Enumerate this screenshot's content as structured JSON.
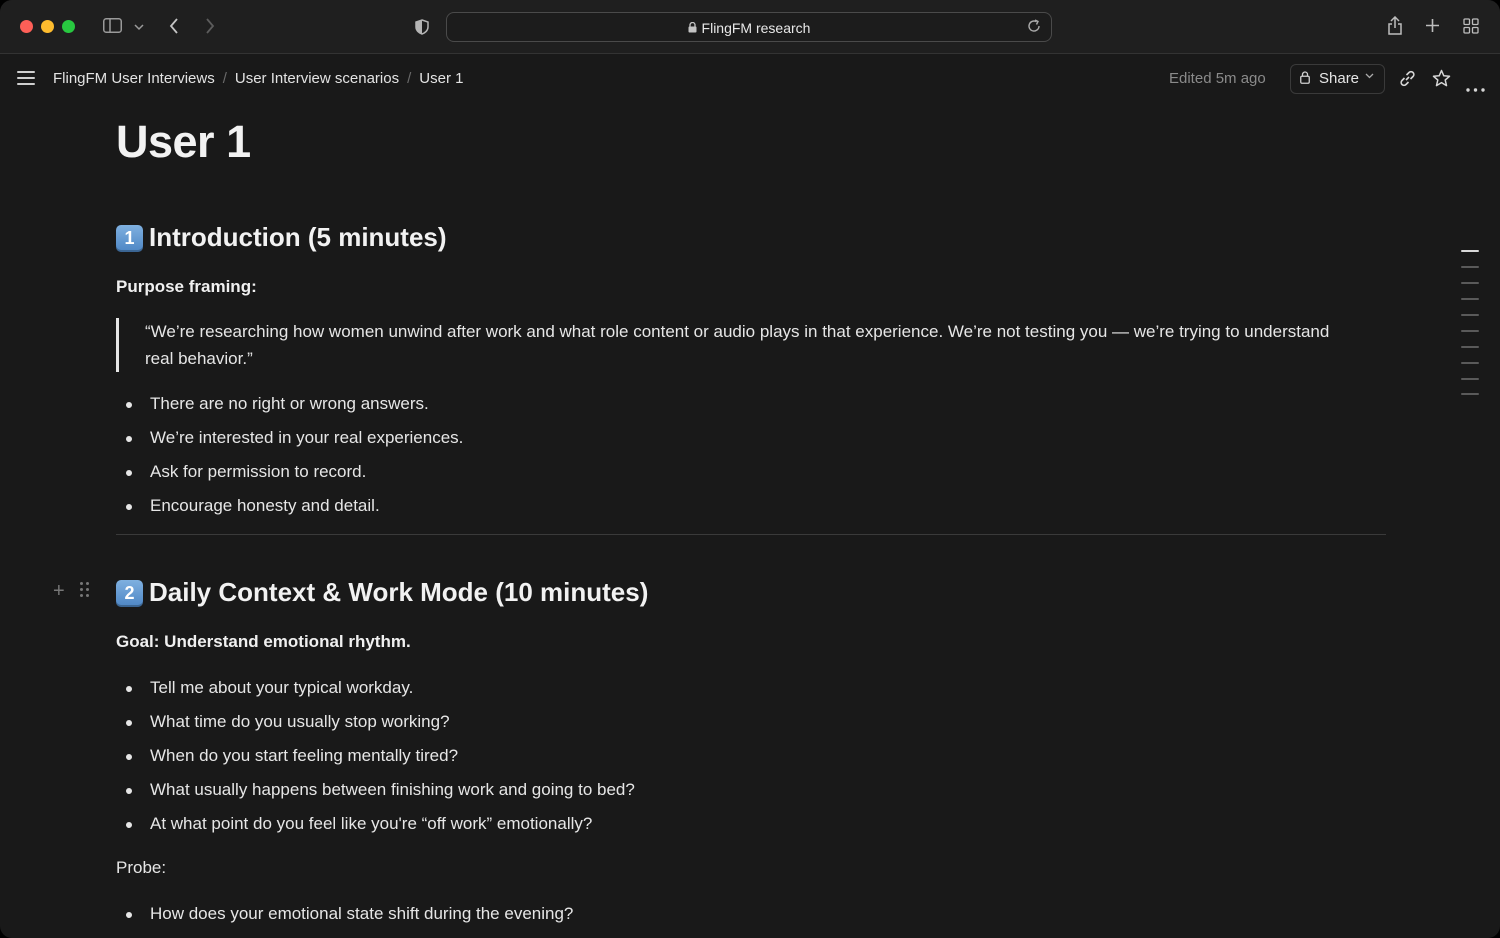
{
  "browser": {
    "url_text": "FlingFM research",
    "icons": [
      "sidebar-toggle-icon",
      "chevron-down-icon",
      "back-icon",
      "forward-icon",
      "shield-icon",
      "lock-icon",
      "reload-icon",
      "share-icon",
      "new-tab-icon",
      "tab-overview-icon"
    ]
  },
  "header": {
    "breadcrumb": [
      "FlingFM User Interviews",
      "User Interview scenarios",
      "User 1"
    ],
    "breadcrumb_sep": "/",
    "edited": "Edited 5m ago",
    "share_label": "Share",
    "icons": [
      "menu-icon",
      "lock-icon",
      "link-icon",
      "star-icon",
      "more-icon"
    ]
  },
  "page": {
    "title": "User 1",
    "section1": {
      "number": "1",
      "heading": "Introduction (5 minutes)",
      "label": "Purpose framing:",
      "quote": "“We’re researching how women unwind after work and what role content or audio plays in that experience. We’re not testing you — we’re trying to understand real behavior.”",
      "bullets": [
        "There are no right or wrong answers.",
        "We’re interested in your real experiences.",
        "Ask for permission to record.",
        "Encourage honesty and detail."
      ]
    },
    "section2": {
      "number": "2",
      "heading": "Daily Context & Work Mode (10 minutes)",
      "goal": "Goal: Understand emotional rhythm.",
      "bullets": [
        "Tell me about your typical workday.",
        "What time do you usually stop working?",
        "When do you start feeling mentally tired?",
        "What usually happens between finishing work and going to bed?",
        "At what point do you feel like you're “off work” emotionally?"
      ],
      "probe_label": "Probe:",
      "probe_bullets": [
        "How does your emotional state shift during the evening?"
      ]
    }
  },
  "colors": {
    "background": "#191919",
    "text": "#e6e6e6",
    "keycap": "#4d86c4"
  }
}
